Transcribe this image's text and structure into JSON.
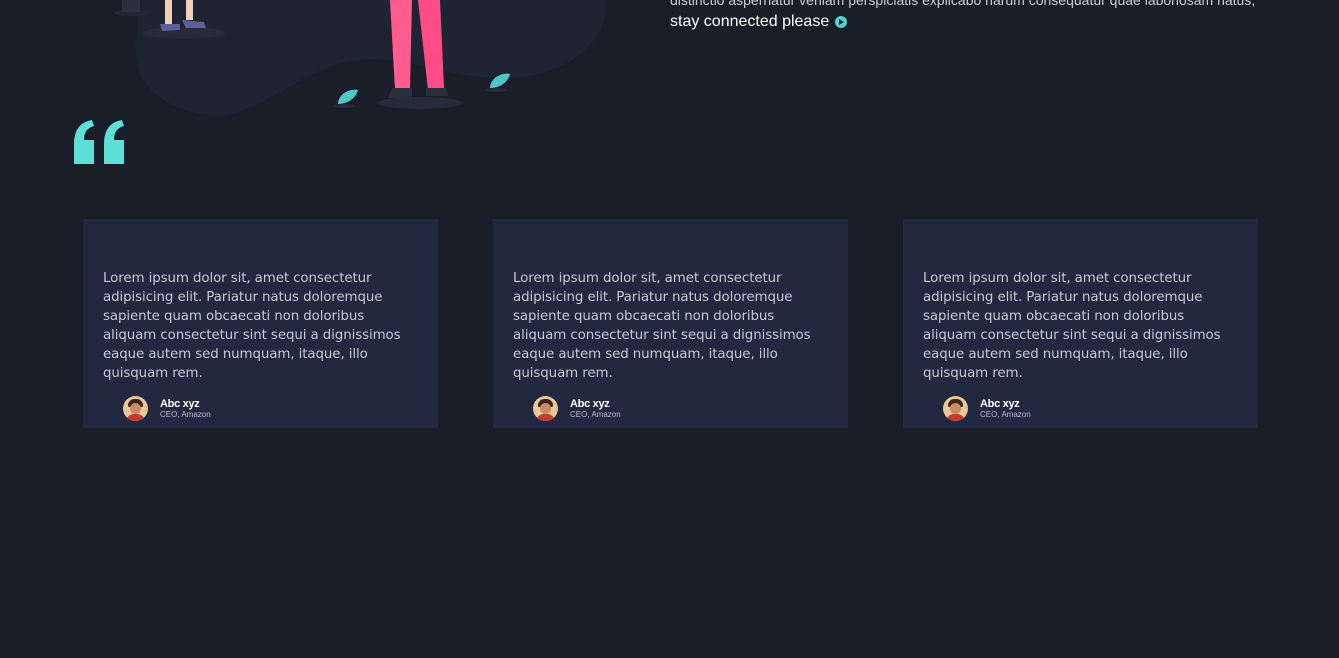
{
  "intro": {
    "text": "distinctio aspernatur veniam perspiciatis explicabo harum consequatur quae laboriosam natus,",
    "link_label": "stay connected please",
    "link_icon": "arrow-right-circle-icon"
  },
  "quote_icon": "quote-mark-icon",
  "colors": {
    "background": "#1a1e28",
    "card": "#212840",
    "accent": "#4dd6cf",
    "pink": "#ff4f8b"
  },
  "testimonials": [
    {
      "text": "Lorem ipsum dolor sit, amet consectetur adipisicing elit. Pariatur natus doloremque sapiente quam obcaecati non doloribus aliquam consectetur sint sequi a dignissimos eaque autem sed numquam, itaque, illo quisquam rem.",
      "name": "Abc xyz",
      "title": "CEO, Amazon"
    },
    {
      "text": "Lorem ipsum dolor sit, amet consectetur adipisicing elit. Pariatur natus doloremque sapiente quam obcaecati non doloribus aliquam consectetur sint sequi a dignissimos eaque autem sed numquam, itaque, illo quisquam rem.",
      "name": "Abc xyz",
      "title": "CEO, Amazon"
    },
    {
      "text": "Lorem ipsum dolor sit, amet consectetur adipisicing elit. Pariatur natus doloremque sapiente quam obcaecati non doloribus aliquam consectetur sint sequi a dignissimos eaque autem sed numquam, itaque, illo quisquam rem.",
      "name": "Abc xyz",
      "title": "CEO, Amazon"
    }
  ]
}
